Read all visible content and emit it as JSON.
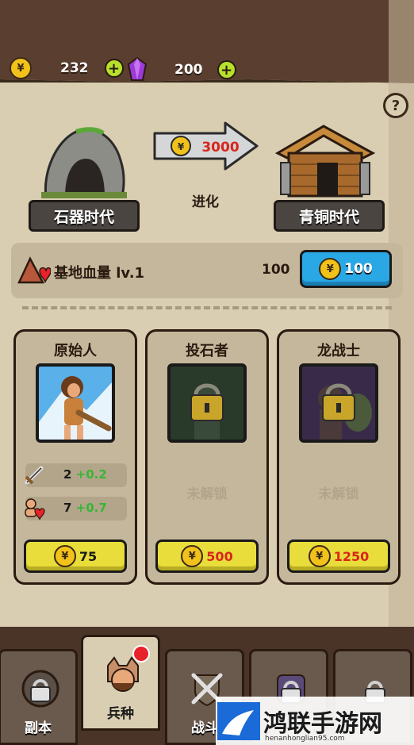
{
  "resources": {
    "coins": "232",
    "gems": "200"
  },
  "evolution": {
    "current_era": "石器时代",
    "next_era": "青铜时代",
    "cost": "3000",
    "action_label": "进化"
  },
  "base_hp": {
    "title": "基地血量 lv.1",
    "value": "100",
    "upgrade_cost": "100"
  },
  "units": [
    {
      "name": "原始人",
      "locked": false,
      "attack": "2",
      "attack_bonus": "+0.2",
      "health": "7",
      "health_bonus": "+0.7",
      "cost": "75"
    },
    {
      "name": "投石者",
      "locked": true,
      "locked_label": "未解锁",
      "cost": "500"
    },
    {
      "name": "龙战士",
      "locked": true,
      "locked_label": "未解锁",
      "cost": "1250"
    }
  ],
  "tabs": [
    {
      "label": "副本"
    },
    {
      "label": "兵种"
    },
    {
      "label": "战斗"
    }
  ],
  "watermark": {
    "text": "鸿联手游网",
    "url": "henanhonglian95.com"
  },
  "colors": {
    "coin": "#f2c21b",
    "plus": "#b6e12a",
    "blue_button": "#2aa8e6",
    "yellow_button": "#e8dd3a",
    "bonus_green": "#38b636",
    "cost_red": "#d8261a"
  }
}
